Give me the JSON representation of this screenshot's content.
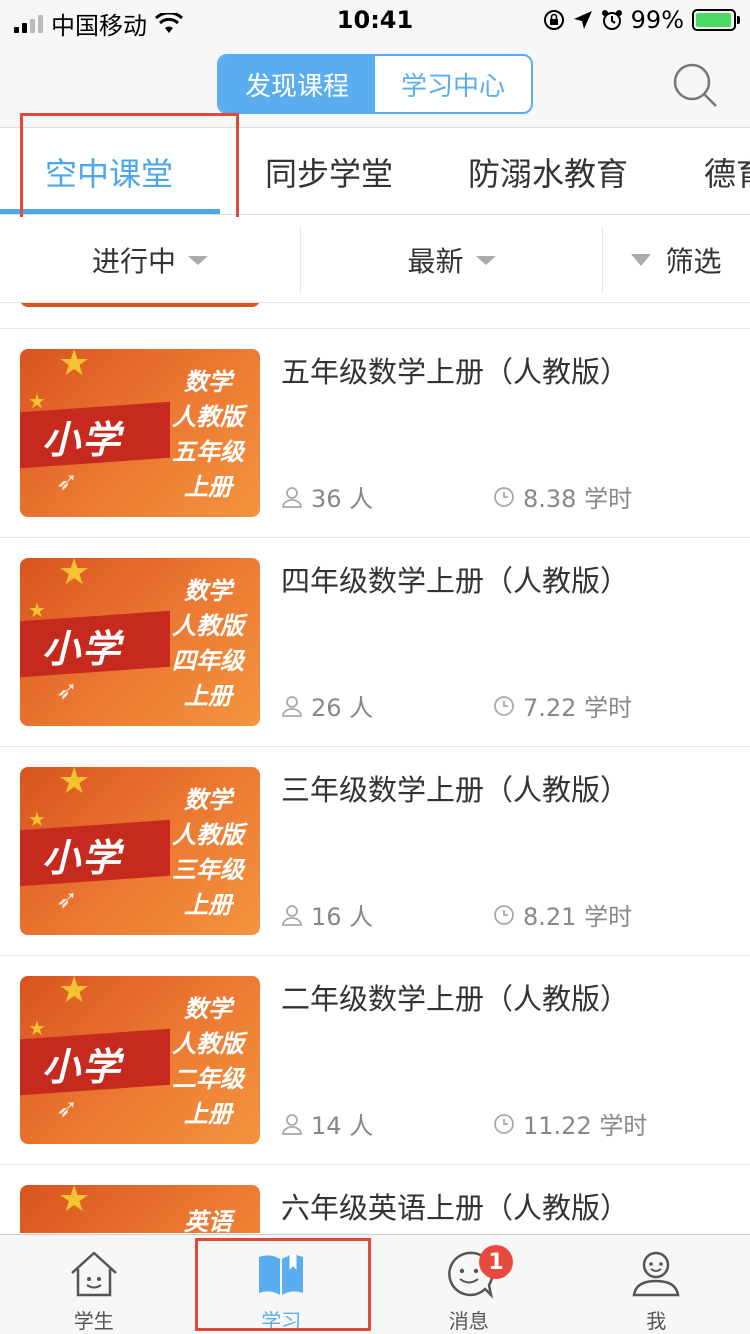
{
  "status_bar": {
    "carrier": "中国移动",
    "time": "10:41",
    "battery": "99%"
  },
  "header": {
    "segments": [
      {
        "label": "发现课程",
        "active": true
      },
      {
        "label": "学习中心",
        "active": false
      }
    ],
    "search_icon": "search-icon"
  },
  "category_tabs": [
    {
      "label": "空中课堂",
      "active": true
    },
    {
      "label": "同步学堂",
      "active": false
    },
    {
      "label": "防溺水教育",
      "active": false
    },
    {
      "label": "德育",
      "active": false
    }
  ],
  "filters": [
    {
      "label": "进行中",
      "has_dropdown": true
    },
    {
      "label": "最新",
      "has_dropdown": true
    },
    {
      "label": "筛选",
      "icon": "funnel-icon"
    }
  ],
  "courses": [
    {
      "title": "五年级数学上册（人教版）",
      "learners": "36 人",
      "hours": "8.38 学时",
      "thumb": {
        "badge": "小学",
        "lines": [
          "数学",
          "人教版",
          "五年级",
          "上册"
        ]
      }
    },
    {
      "title": "四年级数学上册（人教版）",
      "learners": "26 人",
      "hours": "7.22 学时",
      "thumb": {
        "badge": "小学",
        "lines": [
          "数学",
          "人教版",
          "四年级",
          "上册"
        ]
      }
    },
    {
      "title": "三年级数学上册（人教版）",
      "learners": "16 人",
      "hours": "8.21 学时",
      "thumb": {
        "badge": "小学",
        "lines": [
          "数学",
          "人教版",
          "三年级",
          "上册"
        ]
      }
    },
    {
      "title": "二年级数学上册（人教版）",
      "learners": "14 人",
      "hours": "11.22 学时",
      "thumb": {
        "badge": "小学",
        "lines": [
          "数学",
          "人教版",
          "二年级",
          "上册"
        ]
      }
    },
    {
      "title": "六年级英语上册（人教版）",
      "learners": "",
      "hours": "",
      "thumb": {
        "badge": "",
        "lines": [
          "英语"
        ]
      }
    }
  ],
  "bottom_nav": [
    {
      "label": "学生",
      "icon": "house-icon",
      "active": false
    },
    {
      "label": "学习",
      "icon": "book-icon",
      "active": true
    },
    {
      "label": "消息",
      "icon": "chat-face-icon",
      "active": false,
      "badge": "1"
    },
    {
      "label": "我",
      "icon": "person-icon",
      "active": false
    }
  ],
  "colors": {
    "accent": "#5aaef0",
    "highlight_box": "#e04a3a",
    "badge": "#e84b3c",
    "thumb_orange": "#ec7a33"
  }
}
